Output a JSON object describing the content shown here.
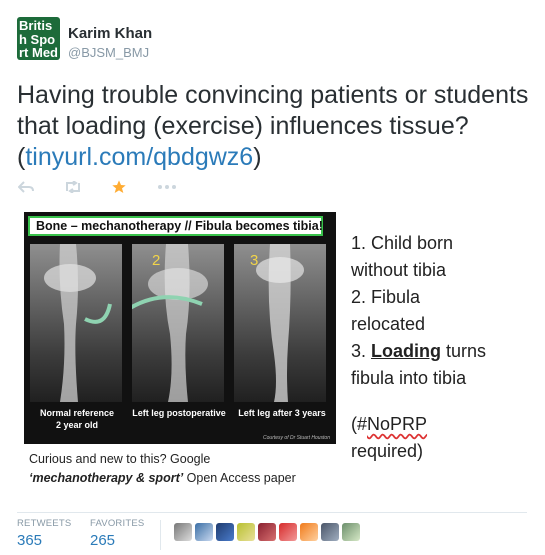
{
  "author": {
    "avatar_text": "British Sport Medicine",
    "name": "Karim Khan",
    "handle": "@BJSM_BMJ"
  },
  "tweet": {
    "text": "Having trouble convincing patients or students that loading (exercise) influences tissue?  (",
    "link": "tinyurl.com/qbdgwz6",
    "text_end": ")"
  },
  "actions": [
    {
      "name": "reply-icon",
      "glyph": "↩"
    },
    {
      "name": "retweet-icon",
      "glyph": "⇄"
    },
    {
      "name": "favorite-icon",
      "glyph": "★"
    },
    {
      "name": "more-icon",
      "glyph": "•••"
    }
  ],
  "media": {
    "panel_title": "Bone – mechanotherapy // Fibula becomes tibia!",
    "numbers": [
      "2",
      "3"
    ],
    "captions": [
      "Normal reference\n2 year old",
      "Left leg postoperative",
      "Left leg after 3 years"
    ],
    "credit": "Courtesy of Dr Stuart Houston",
    "below_line1": "Curious and new to this? Google",
    "below_bold": "‘mechanotherapy & sport’",
    "below_line2_rest": " Open Access paper",
    "side": {
      "l1": "1. Child born",
      "l2": "without tibia",
      "l3": "2. Fibula",
      "l4": "relocated",
      "l5_pre": "3. ",
      "l5_u": "Loading",
      "l5_post": " turns",
      "l6": "fibula into tibia",
      "l7_pre": "(#",
      "l7_u": "NoPRP",
      "l8": "required)"
    }
  },
  "stats": {
    "retweets_label": "RETWEETS",
    "retweets": "365",
    "favorites_label": "FAVORITES",
    "favorites": "265"
  },
  "colors": {
    "link": "#2b7bb9",
    "star": "#ffac33",
    "icon": "#ccd6dd",
    "muted": "#8899a6"
  }
}
